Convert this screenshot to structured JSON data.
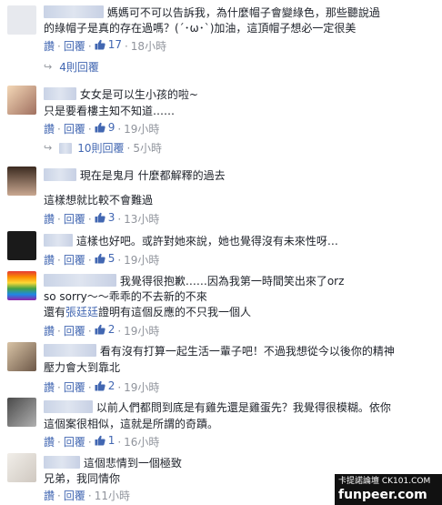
{
  "comments": [
    {
      "text_lines": [
        "媽媽可不可以告訴我，為什麼帽子會變綠色，那些聽說過",
        "的綠帽子是真的存在過嗎？(´･ω･`)加油，這頂帽子想必一定很美"
      ],
      "actions": {
        "like": "讚",
        "reply": "回覆",
        "likes": "17",
        "time": "18小時"
      },
      "replies": "4則回覆"
    },
    {
      "text_lines": [
        "女女是可以生小孩的啦~",
        "只是要看樓主知不知道……"
      ],
      "actions": {
        "like": "讚",
        "reply": "回覆",
        "likes": "9",
        "time": "19小時"
      },
      "replies": "10則回覆",
      "replies_time": "5小時"
    },
    {
      "text_lines": [
        "現在是鬼月 什麼都解釋的過去",
        "這樣想就比較不會難過"
      ],
      "actions": {
        "like": "讚",
        "reply": "回覆",
        "likes": "3",
        "time": "13小時"
      }
    },
    {
      "text_lines": [
        "這樣也好吧。或許對她來說，她也覺得沒有未來性呀…"
      ],
      "actions": {
        "like": "讚",
        "reply": "回覆",
        "likes": "5",
        "time": "19小時"
      }
    },
    {
      "text_lines": [
        "我覺得很抱歉……因為我第一時間笑出來了orz",
        "so sorry～～乖乖的不去新的不來",
        "還有",
        "證明有這個反應的不只我一個人"
      ],
      "tag": "張廷廷",
      "actions": {
        "like": "讚",
        "reply": "回覆",
        "likes": "2",
        "time": "19小時"
      }
    },
    {
      "text_lines": [
        "看有沒有打算一起生活一輩子吧！不過我想從今以後你的精神",
        "壓力會大到靠北"
      ],
      "actions": {
        "like": "讚",
        "reply": "回覆",
        "likes": "2",
        "time": "19小時"
      }
    },
    {
      "text_lines": [
        "以前人們都問到底是有雞先還是雞蛋先？我覺得很模糊。依你",
        "這個案很相似，這就是所謂的奇蹟。"
      ],
      "actions": {
        "like": "讚",
        "reply": "回覆",
        "likes": "1",
        "time": "16小時"
      }
    },
    {
      "text_lines": [
        "這個悲情到一個極致",
        "兄弟，我同情你"
      ],
      "actions": {
        "like": "讚",
        "reply": "回覆",
        "time": "11小時"
      }
    }
  ],
  "watermark": {
    "line1": "卡提諾論壇 CK101.COM",
    "line2": "funpeer.com"
  },
  "colors": {
    "link": "#4267b2",
    "muted": "#90949c",
    "text": "#1d2129"
  }
}
